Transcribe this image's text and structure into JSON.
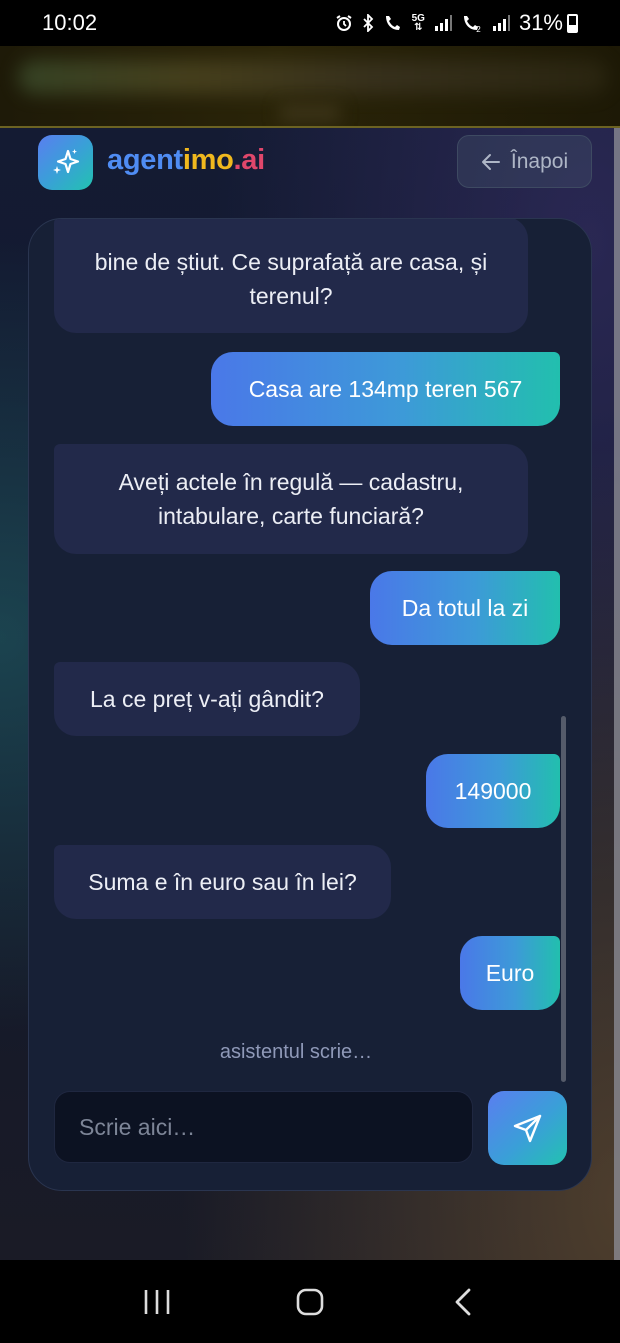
{
  "status_bar": {
    "time": "10:02",
    "fiveg_top": "5G",
    "fiveg_bottom": "⇅",
    "battery": "31%"
  },
  "header": {
    "brand_part1": "agent",
    "brand_part2": "imo",
    "brand_part3": ".ai",
    "back_label": "Înapoi",
    "logo_icon": "sparkles-icon"
  },
  "chat": {
    "messages": [
      {
        "role": "assistant",
        "text": "bine de știut. Ce suprafață are casa, și terenul?"
      },
      {
        "role": "user",
        "text": "Casa are 134mp teren 567"
      },
      {
        "role": "assistant",
        "text": "Aveți actele în regulă — cadastru, intabulare, carte funciară?"
      },
      {
        "role": "user",
        "text": "Da totul la zi"
      },
      {
        "role": "assistant",
        "text": "La ce preț v-ați gândit?"
      },
      {
        "role": "user",
        "text": "149000"
      },
      {
        "role": "assistant",
        "text": "Suma e în euro sau în lei?"
      },
      {
        "role": "user",
        "text": "Euro"
      }
    ],
    "typing_indicator": "asistentul scrie…",
    "input_placeholder": "Scrie aici…",
    "input_value": "",
    "send_icon": "send-icon"
  },
  "colors": {
    "brand_blue": "#4f8cf3",
    "brand_yellow": "#f0b81e",
    "brand_red": "#e0476b",
    "user_gradient_start": "#4a78e8",
    "user_gradient_end": "#22bfae",
    "assistant_bubble": "#22294a",
    "card_background": "#172036"
  }
}
